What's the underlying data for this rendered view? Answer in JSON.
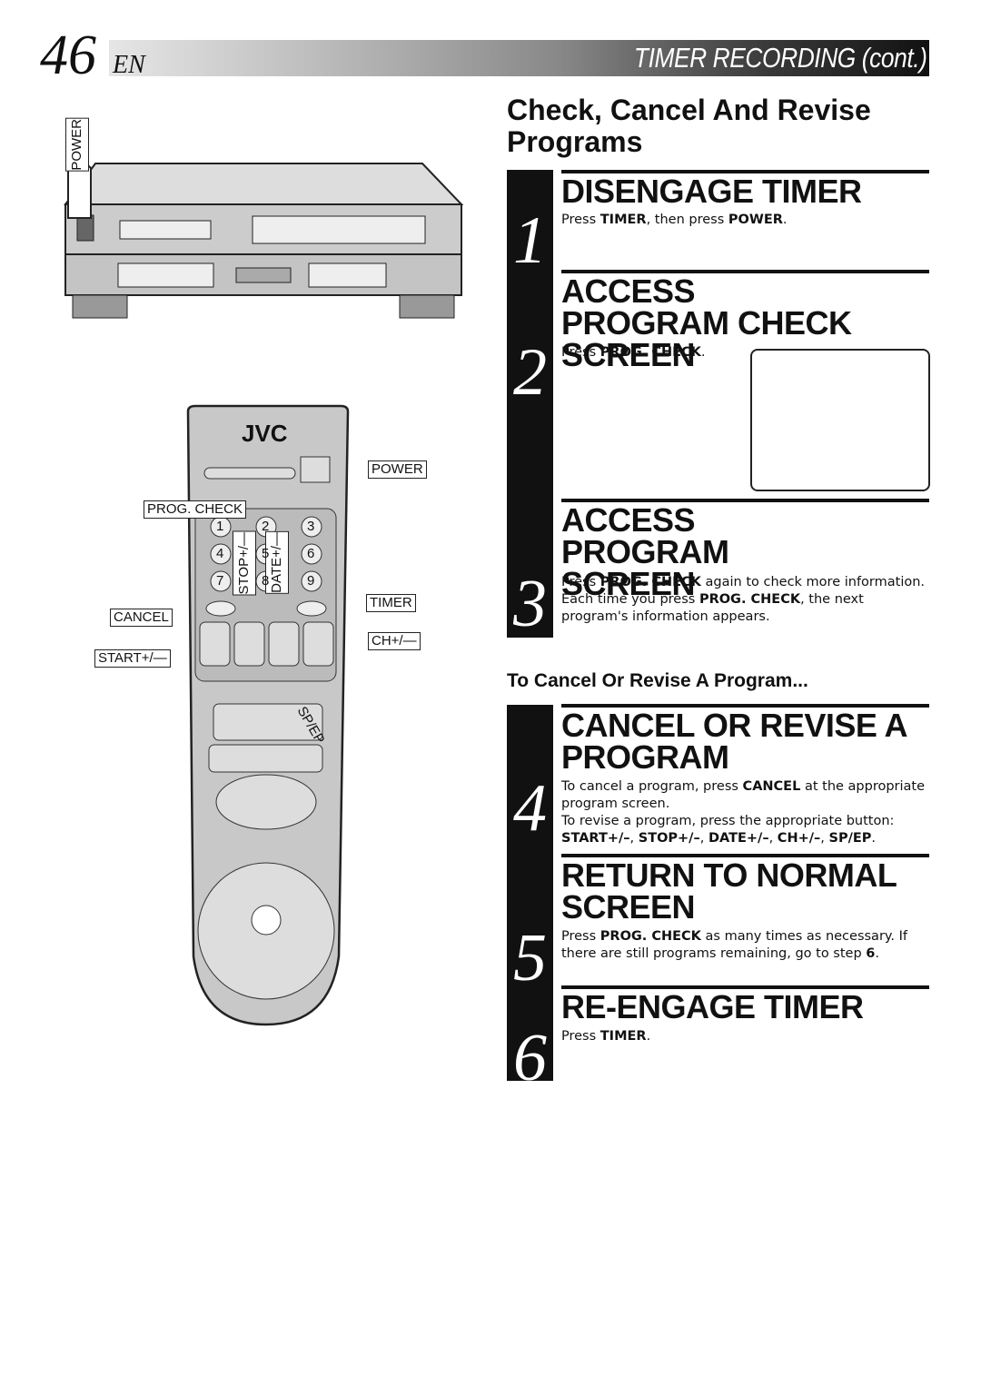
{
  "header": {
    "page_number": "46",
    "language": "EN",
    "section": "TIMER RECORDING (cont.)"
  },
  "title": "Check, Cancel And Revise Programs",
  "subtitle": "To Cancel Or Revise A Program...",
  "steps": [
    {
      "num": "1",
      "heading": "DISENGAGE TIMER",
      "desc": [
        "Press ",
        {
          "b": "TIMER"
        },
        ", then press ",
        {
          "b": "POWER"
        },
        "."
      ]
    },
    {
      "num": "2",
      "heading": "ACCESS PROGRAM CHECK SCREEN",
      "desc": [
        "Press ",
        {
          "b": "PROG. CHECK"
        },
        "."
      ]
    },
    {
      "num": "3",
      "heading": "ACCESS PROGRAM SCREEN",
      "desc": [
        "Press ",
        {
          "b": "PROG. CHECK"
        },
        " again to check more information. Each time you press ",
        {
          "b": "PROG. CHECK"
        },
        ", the next program's information appears."
      ]
    },
    {
      "num": "4",
      "heading": "CANCEL OR REVISE A PROGRAM",
      "desc": [
        "To cancel a program, press ",
        {
          "b": "CANCEL"
        },
        " at the appropriate program screen.",
        {
          "br": 1
        },
        "To revise a program, press the appropriate button: ",
        {
          "b": "START+/–"
        },
        ", ",
        {
          "b": "STOP+/–"
        },
        ", ",
        {
          "b": "DATE+/–"
        },
        ", ",
        {
          "b": "CH+/–"
        },
        ", ",
        {
          "b": "SP/EP"
        },
        "."
      ]
    },
    {
      "num": "5",
      "heading": "RETURN TO NORMAL SCREEN",
      "desc": [
        "Press ",
        {
          "b": "PROG. CHECK"
        },
        " as many times as necessary. If there are still programs remaining, go to step ",
        {
          "b": "6"
        },
        "."
      ]
    },
    {
      "num": "6",
      "heading": "RE-ENGAGE TIMER",
      "desc": [
        "Press ",
        {
          "b": "TIMER"
        },
        "."
      ]
    }
  ],
  "illustration": {
    "vcr_label": "POWER",
    "remote_brand": "JVC",
    "remote_labels": {
      "power": "POWER",
      "prog_check": "PROG. CHECK",
      "cancel": "CANCEL",
      "timer": "TIMER",
      "start": "START+/—",
      "ch": "CH+/—",
      "stop": "STOP+/—",
      "date": "DATE+/—",
      "spep": "SP/EP"
    },
    "keys": [
      "1",
      "2",
      "3",
      "4",
      "5",
      "6",
      "7",
      "8",
      "9"
    ]
  }
}
